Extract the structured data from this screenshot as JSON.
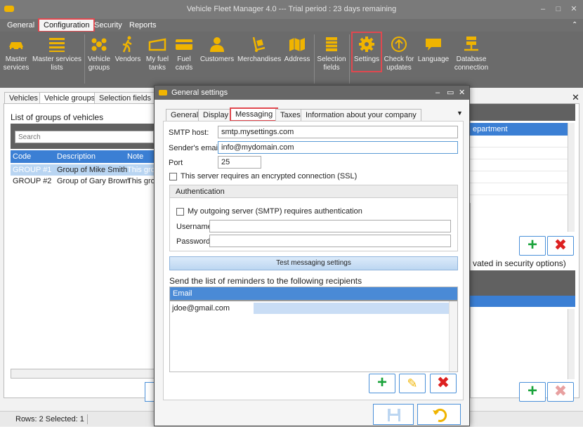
{
  "window": {
    "title": "Vehicle Fleet Manager 4.0 --- Trial period : 23 days remaining"
  },
  "menu": [
    "General",
    "Configuration",
    "Security",
    "Reports"
  ],
  "ribbon": {
    "master_services": [
      "Master",
      "services"
    ],
    "master_services_lists": [
      "Master services",
      "lists"
    ],
    "vehicle_groups": [
      "Vehicle",
      "groups"
    ],
    "vendors": [
      "Vendors",
      ""
    ],
    "my_fuel_tanks": [
      "My fuel",
      "tanks"
    ],
    "fuel_cards": [
      "Fuel",
      "cards"
    ],
    "customers": [
      "Customers",
      ""
    ],
    "merchandises": [
      "Merchandises",
      ""
    ],
    "address": [
      "Address",
      ""
    ],
    "selection_fields": [
      "Selection",
      "fields"
    ],
    "settings": [
      "Settings",
      ""
    ],
    "check_updates": [
      "Check for",
      "updates"
    ],
    "language": [
      "Language",
      ""
    ],
    "database_connection": [
      "Database",
      "connection"
    ]
  },
  "main_tabs": [
    "Vehicles",
    "Vehicle groups",
    "Selection fields"
  ],
  "left_panel": {
    "title": "List of groups of vehicles",
    "search_placeholder": "Search",
    "columns": [
      "Code",
      "Description",
      "Note"
    ],
    "rows": [
      [
        "GROUP #1",
        "Group of Mike Smith",
        "This grou"
      ],
      [
        "GROUP #2",
        "Group of Gary Brown",
        "This grou"
      ]
    ]
  },
  "right_panel": {
    "column": "epartment",
    "security_text": "vated in security options)"
  },
  "status": {
    "rows": "Rows: 2  Selected: 1"
  },
  "dialog": {
    "title": "General settings",
    "tabs": [
      "General",
      "Display",
      "Messaging",
      "Taxes",
      "Information about your company"
    ],
    "smtp_host_label": "SMTP host:",
    "smtp_host_value": "smtp.mysettings.com",
    "sender_email_label": "Sender's email:",
    "sender_email_value": "info@mydomain.com",
    "port_label": "Port",
    "port_value": "25",
    "ssl_label": "This server requires an encrypted connection (SSL)",
    "auth_title": "Authentication",
    "auth_label": "My outgoing server (SMTP) requires authentication",
    "username_label": "Username:",
    "password_label": "Password:",
    "test_button": "Test messaging settings",
    "reminders_title": "Send the list of reminders to the following recipients",
    "email_column": "Email",
    "emails": [
      "jdoe@gmail.com"
    ]
  },
  "colors": {
    "accent": "#3b7fd4",
    "highlight": "#e0484f",
    "ribbon": "#6b6b6b"
  }
}
